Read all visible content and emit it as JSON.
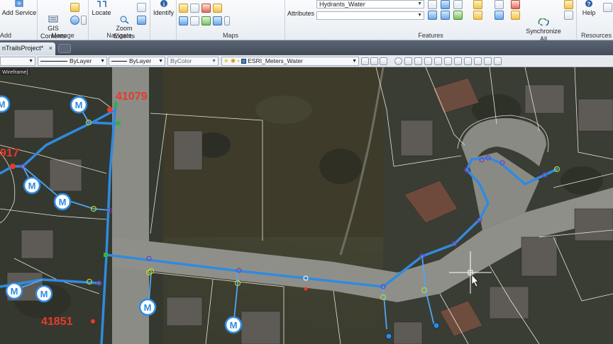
{
  "ribbon": {
    "add_group": {
      "add_service_label": "Add Service",
      "group_label": "Add"
    },
    "manage_group": {
      "gis_contents_label": "GIS\nContents",
      "group_label": "Manage"
    },
    "navigate_group": {
      "locate_label": "Locate",
      "zoom_extents_label": "Zoom\nExtents",
      "group_label": "Navigate"
    },
    "identify_label": "Identify",
    "maps_group": {
      "group_label": "Maps"
    },
    "features_group": {
      "attributes_label": "Attributes",
      "layer_combo_value": "Hydrants_Water",
      "subtype_combo_value": "",
      "group_label": "Features",
      "synchronize_label": "Synchronize\nAll"
    },
    "resources_group": {
      "help_label": "Help",
      "group_label": "Resources"
    }
  },
  "tabs": {
    "document_tab": "nTrailsProject*",
    "close_glyph": "×"
  },
  "properties_bar": {
    "linetype_1": "ByLayer",
    "linetype_2": "ByLayer",
    "color": "ByColor",
    "layer": "ESRI_Meters_Water"
  },
  "map": {
    "viewport_label": "Wireframe]",
    "labels": [
      "41079",
      "917",
      "41851"
    ],
    "meter_symbol": "M",
    "colors": {
      "water_main": "#2f8be0",
      "label": "#e63a2c",
      "vertex": "#7b3fb8"
    }
  }
}
